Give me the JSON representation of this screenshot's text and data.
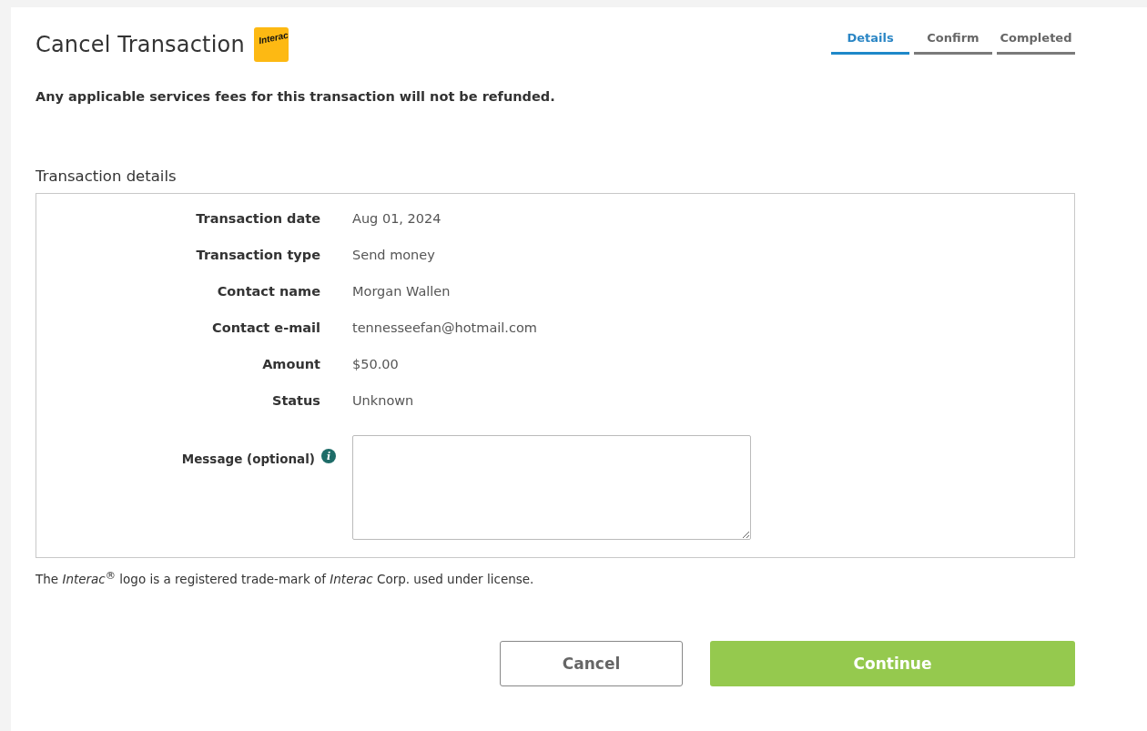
{
  "title": "Cancel Transaction",
  "logo": {
    "text": "Interac"
  },
  "steps": [
    {
      "label": "Details",
      "selected": true
    },
    {
      "label": "Confirm",
      "selected": false
    },
    {
      "label": "Completed",
      "selected": false
    }
  ],
  "notice": "Any applicable services fees for this transaction will not be refunded.",
  "section_title": "Transaction details",
  "details": [
    {
      "label": "Transaction date",
      "value": "Aug 01, 2024"
    },
    {
      "label": "Transaction type",
      "value": "Send money"
    },
    {
      "label": "Contact name",
      "value": "Morgan Wallen"
    },
    {
      "label": "Contact e-mail",
      "value": "tennesseefan@hotmail.com"
    },
    {
      "label": "Amount",
      "value": "$50.00"
    },
    {
      "label": "Status",
      "value": "Unknown"
    }
  ],
  "message": {
    "label": "Message (optional)",
    "info_icon": "i"
  },
  "footnote": "The *Interac*$^{®}$ logo is a registered trade-mark of *Interac* Corp. used under license.",
  "buttons": [
    {
      "kind": "secondary",
      "label": "Cancel"
    },
    {
      "kind": "primary",
      "label": "Continue"
    }
  ]
}
